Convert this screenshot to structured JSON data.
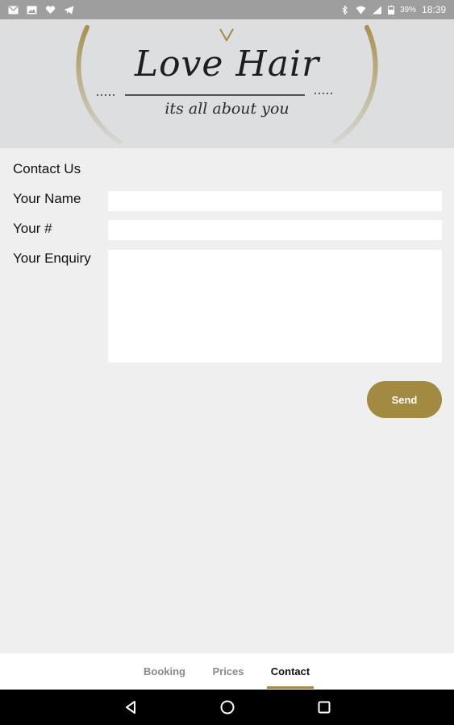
{
  "status_bar": {
    "left_icons": [
      "mail-icon",
      "image-icon",
      "heart-message-icon",
      "telegram-icon"
    ],
    "right_icons": [
      "bluetooth-icon",
      "wifi-icon",
      "signal-icon",
      "battery-icon"
    ],
    "battery_percent": "39%",
    "time": "18:39"
  },
  "header": {
    "logo_title": "Love Hair",
    "logo_tagline": "its all about you",
    "accent_color": "#a28a40"
  },
  "form": {
    "title": "Contact Us",
    "name_label": "Your Name",
    "name_value": "",
    "number_label": "Your #",
    "number_value": "",
    "enquiry_label": "Your Enquiry",
    "enquiry_value": "",
    "send_label": "Send"
  },
  "tabs": [
    {
      "label": "Booking",
      "active": false
    },
    {
      "label": "Prices",
      "active": false
    },
    {
      "label": "Contact",
      "active": true
    }
  ],
  "nav_bar": {
    "buttons": [
      "back-icon",
      "home-icon",
      "recents-icon"
    ]
  }
}
